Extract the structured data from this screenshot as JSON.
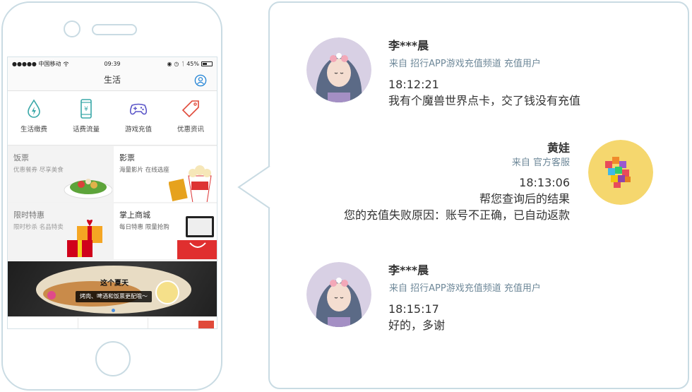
{
  "phone": {
    "status": {
      "carrier": "●●●●● 中国移动",
      "time": "09:39",
      "battery": "45%"
    },
    "header": {
      "title": "生活"
    },
    "quick_actions": [
      {
        "label": "生活缴费",
        "icon": "water-drop-bolt-icon",
        "color": "#3aa8a8"
      },
      {
        "label": "话费流量",
        "icon": "phone-yuan-icon",
        "color": "#3aa8a8"
      },
      {
        "label": "游戏充值",
        "icon": "gamepad-icon",
        "color": "#5a55c8"
      },
      {
        "label": "优惠资讯",
        "icon": "tag-icon",
        "color": "#e04a3a"
      }
    ],
    "cards": [
      {
        "title": "饭票",
        "sub": "优惠餐券 尽享美食"
      },
      {
        "title": "影票",
        "sub": "海量影片 在线选座"
      },
      {
        "title": "限时特惠",
        "sub": "限时秒杀 名品特卖"
      },
      {
        "title": "掌上商城",
        "sub": "每日特惠 限量抢购"
      }
    ],
    "banner": {
      "title": "这个夏天",
      "sub": "烤肉、啤酒和饭票更配哦～"
    }
  },
  "messages": [
    {
      "name": "李***晨",
      "from": "来自 招行APP游戏充值频道 充值用户",
      "time": "18:12:21",
      "lines": [
        "我有个魔兽世界点卡，交了钱没有充值"
      ]
    },
    {
      "name": "黄娃",
      "from": "来自 官方客服",
      "time": "18:13:06",
      "lines": [
        "帮您查询后的结果",
        "您的充值失败原因：账号不正确，已自动返款"
      ]
    },
    {
      "name": "李***晨",
      "from": "来自 招行APP游戏充值频道 充值用户",
      "time": "18:15:17",
      "lines": [
        "好的，多谢"
      ]
    }
  ],
  "colors": {
    "frame": "#c9dbe3",
    "from_text": "#6e8899",
    "agent_avatar_bg": "#f5d76e",
    "accent_blue": "#1a7fd4"
  }
}
